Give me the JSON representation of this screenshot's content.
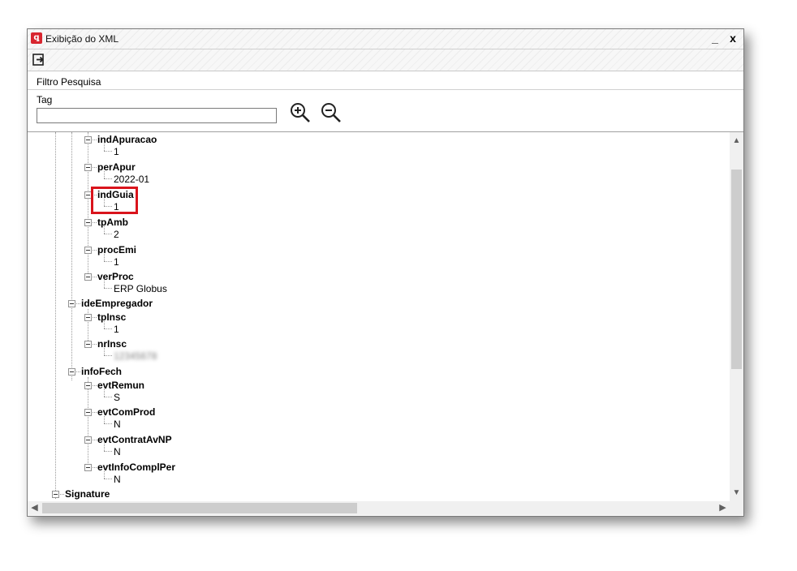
{
  "window": {
    "title": "Exibição do XML",
    "icon": "app-logo-icon",
    "minimize_label": "_",
    "close_label": "x"
  },
  "toolbar": {
    "exit_icon": "exit-icon"
  },
  "filter": {
    "group_label": "Filtro Pesquisa",
    "tag_label": "Tag",
    "tag_value": "",
    "zoom_in_icon": "zoom-in-icon",
    "zoom_out_icon": "zoom-out-icon"
  },
  "tree": {
    "indApuracao": "indApuracao",
    "indApuracao_value": "1",
    "perApur": "perApur",
    "perApur_value": "2022-01",
    "indGuia": "indGuia",
    "indGuia_value": "1",
    "tpAmb": "tpAmb",
    "tpAmb_value": "2",
    "procEmi": "procEmi",
    "procEmi_value": "1",
    "verProc": "verProc",
    "verProc_value": "ERP Globus",
    "ideEmpregador": "ideEmpregador",
    "tpInsc": "tpInsc",
    "tpInsc_value": "1",
    "nrInsc": "nrInsc",
    "nrInsc_value": "12345678",
    "infoFech": "infoFech",
    "evtRemun": "evtRemun",
    "evtRemun_value": "S",
    "evtComProd": "evtComProd",
    "evtComProd_value": "N",
    "evtContratAvNP": "evtContratAvNP",
    "evtContratAvNP_value": "N",
    "evtInfoComplPer": "evtInfoComplPer",
    "evtInfoComplPer_value": "N",
    "Signature": "Signature"
  },
  "colors": {
    "highlight": "#d9141c",
    "app_icon": "#d8262f"
  }
}
